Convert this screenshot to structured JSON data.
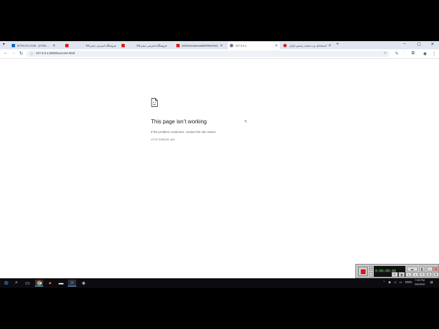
{
  "browser": {
    "tabs": [
      {
        "title": "MTFILES.COM - (HTML ...",
        "favicon_color": "#1565c0",
        "active": false
      },
      {
        "title": "",
        "favicon_color": "#e02020",
        "active": false
      },
      {
        "title": "فروشگاه اینترنتی دیجی‌کالا",
        "favicon_color": "#e02020",
        "active": false
      },
      {
        "title": "فروشگاه اینترنتی دیجی‌کالا",
        "favicon_color": "#e02020",
        "active": false
      },
      {
        "title": "d550a3a4de4ad8680f9a93e2cc...",
        "favicon_color": "#e02020",
        "active": false
      },
      {
        "title": "127.0.0.1",
        "favicon_color": "#777777",
        "active": true
      },
      {
        "title": "استخدام، وب سایت رسمی قران",
        "favicon_color": "#c62828",
        "active": false
      }
    ],
    "new_tab_label": "+",
    "address_bar": {
      "url": "127.0.0.1:5500/success.html"
    }
  },
  "error_page": {
    "title": "This page isn’t working",
    "message": "If the problem continues, contact the site owner.",
    "code": "HTTP ERROR 405"
  },
  "recorder": {
    "display_text": "0:00:00:00"
  },
  "taskbar": {
    "language": "ENG",
    "time": "7:00 PM",
    "date": "9/6/2026"
  },
  "colors": {
    "accent": "#1a73e8",
    "record": "#e01515",
    "taskbar": "#0c0c10"
  }
}
